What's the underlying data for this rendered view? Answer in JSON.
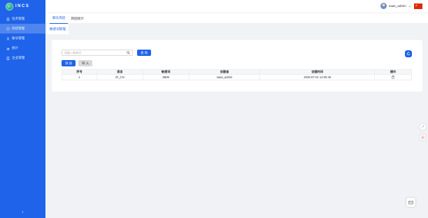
{
  "brand": {
    "logo_text": "INCS"
  },
  "sidebar": {
    "items": [
      {
        "label": "任务管理",
        "icon": "clipboard-icon",
        "active": false
      },
      {
        "label": "风控管理",
        "icon": "shield-icon",
        "active": true
      },
      {
        "label": "账号管理",
        "icon": "user-icon",
        "active": false
      },
      {
        "label": "统计",
        "icon": "chart-icon",
        "active": false
      },
      {
        "label": "企业管理",
        "icon": "building-icon",
        "active": false
      }
    ],
    "collapse_icon": "chevron-left-icon"
  },
  "header": {
    "username": "saas_admin",
    "flag": "china-flag-icon"
  },
  "top_tabs": [
    {
      "label": "聊天风控",
      "active": true
    },
    {
      "label": "风控统计",
      "active": false
    }
  ],
  "page_tab": {
    "label": "敏感词管理"
  },
  "search": {
    "placeholder": "请输入敏感词",
    "value": "",
    "query_label": "查 询"
  },
  "actions": {
    "add_label": "添 加",
    "import_label": "导 入"
  },
  "table": {
    "headers": [
      "序号",
      "语言",
      "敏感词",
      "创建者",
      "创建时间",
      "操作"
    ],
    "rows": [
      {
        "index": "1",
        "language": "zh_CN",
        "word": "8808",
        "creator": "saas_admin",
        "created_at": "2025-07-01 12:00:45",
        "action_icon": "trash-icon"
      }
    ]
  },
  "colors": {
    "accent": "#1e63e9",
    "sidebar_bg": "#1e63e9"
  }
}
